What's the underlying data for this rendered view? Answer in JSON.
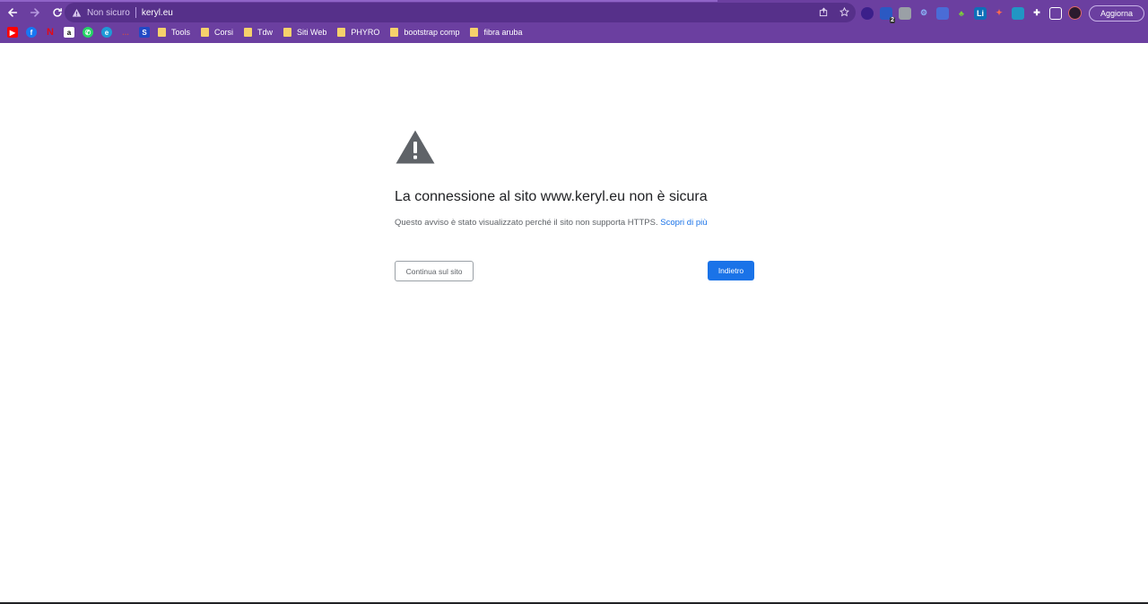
{
  "browser": {
    "security_label": "Non sicuro",
    "url": "keryl.eu",
    "update_button": "Aggiorna",
    "extension_badge": "2"
  },
  "bookmarks": {
    "icons": [
      "youtube-icon",
      "facebook-icon",
      "netflix-icon",
      "amazon-icon",
      "whatsapp-icon",
      "edge-icon",
      "bookmark-icon",
      "s-icon"
    ],
    "folders": [
      "Tools",
      "Corsi",
      "Tdw",
      "Siti Web",
      "PHYRO",
      "bootstrap comp",
      "fibra aruba"
    ]
  },
  "interstitial": {
    "title": "La connessione al sito www.keryl.eu non è sicura",
    "description": "Questo avviso è stato visualizzato perché il sito non supporta HTTPS.",
    "learn_more": "Scopri di più",
    "continue_button": "Continua sul sito",
    "back_button": "Indietro"
  },
  "colors": {
    "chrome": "#6b3fa0",
    "accent": "#1a73e8",
    "warning_icon": "#5f6368"
  }
}
